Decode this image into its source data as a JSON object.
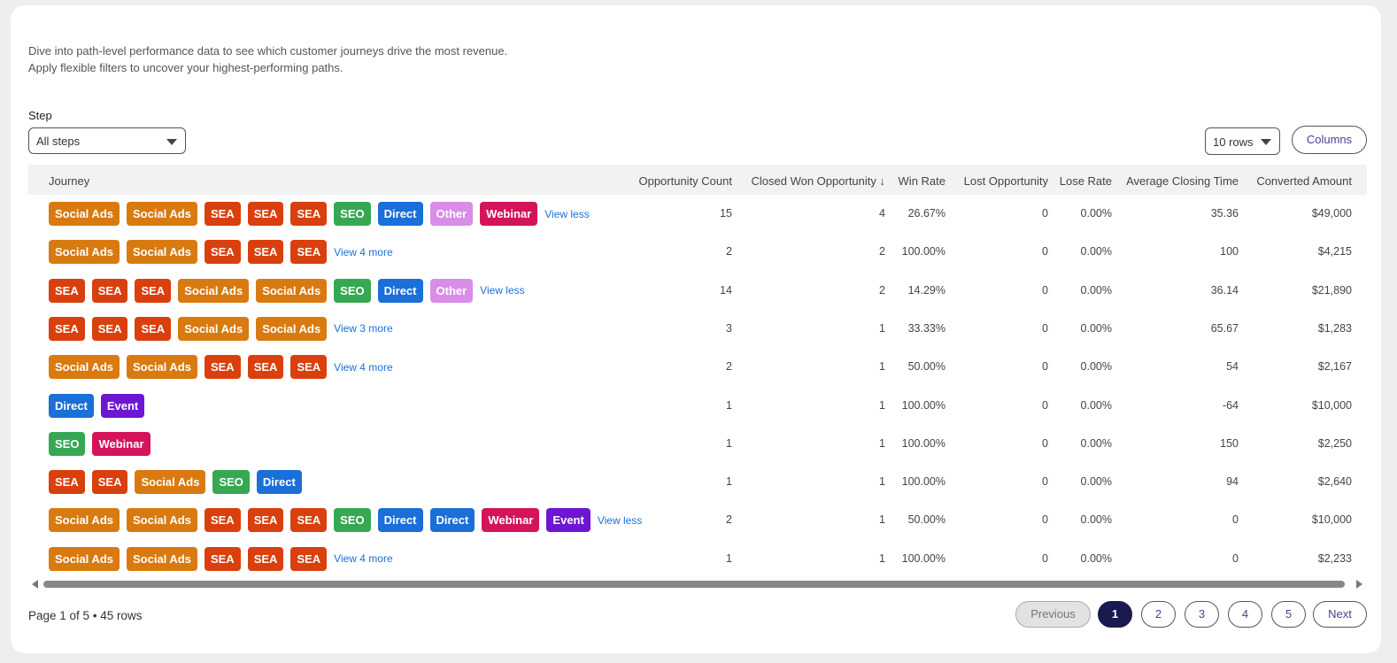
{
  "description": {
    "line1": "Dive into path-level performance data to see which customer journeys drive the most revenue.",
    "line2": "Apply flexible filters to uncover your highest-performing paths."
  },
  "filter": {
    "step_label": "Step",
    "step_value": "All steps"
  },
  "controls": {
    "rows_value": "10 rows",
    "columns_label": "Columns"
  },
  "table": {
    "headers": {
      "journey": "Journey",
      "opp_count": "Opportunity Count",
      "closed_won": "Closed Won Opportunity ↓",
      "win_rate": "Win Rate",
      "lost_opp": "Lost Opportunity",
      "lose_rate": "Lose Rate",
      "avg_closing": "Average Closing Time",
      "converted": "Converted Amount"
    },
    "tag_colors": {
      "Social Ads": "#d97a10",
      "SEA": "#d9400e",
      "SEO": "#36a853",
      "Direct": "#1a6fd8",
      "Other": "#d98de8",
      "Webinar": "#d4145a",
      "Event": "#6c16d4"
    },
    "rows": [
      {
        "tags": [
          "Social Ads",
          "Social Ads",
          "SEA",
          "SEA",
          "SEA",
          "SEO",
          "Direct",
          "Other",
          "Webinar"
        ],
        "more": "View less",
        "opp_count": "15",
        "closed_won": "4",
        "win_rate": "26.67%",
        "lost_opp": "0",
        "lose_rate": "0.00%",
        "avg_closing": "35.36",
        "converted": "$49,000"
      },
      {
        "tags": [
          "Social Ads",
          "Social Ads",
          "SEA",
          "SEA",
          "SEA"
        ],
        "more": "View 4 more",
        "opp_count": "2",
        "closed_won": "2",
        "win_rate": "100.00%",
        "lost_opp": "0",
        "lose_rate": "0.00%",
        "avg_closing": "100",
        "converted": "$4,215"
      },
      {
        "tags": [
          "SEA",
          "SEA",
          "SEA",
          "Social Ads",
          "Social Ads",
          "SEO",
          "Direct",
          "Other"
        ],
        "more": "View less",
        "opp_count": "14",
        "closed_won": "2",
        "win_rate": "14.29%",
        "lost_opp": "0",
        "lose_rate": "0.00%",
        "avg_closing": "36.14",
        "converted": "$21,890"
      },
      {
        "tags": [
          "SEA",
          "SEA",
          "SEA",
          "Social Ads",
          "Social Ads"
        ],
        "more": "View 3 more",
        "opp_count": "3",
        "closed_won": "1",
        "win_rate": "33.33%",
        "lost_opp": "0",
        "lose_rate": "0.00%",
        "avg_closing": "65.67",
        "converted": "$1,283"
      },
      {
        "tags": [
          "Social Ads",
          "Social Ads",
          "SEA",
          "SEA",
          "SEA"
        ],
        "more": "View 4 more",
        "opp_count": "2",
        "closed_won": "1",
        "win_rate": "50.00%",
        "lost_opp": "0",
        "lose_rate": "0.00%",
        "avg_closing": "54",
        "converted": "$2,167"
      },
      {
        "tags": [
          "Direct",
          "Event"
        ],
        "more": "",
        "opp_count": "1",
        "closed_won": "1",
        "win_rate": "100.00%",
        "lost_opp": "0",
        "lose_rate": "0.00%",
        "avg_closing": "-64",
        "converted": "$10,000"
      },
      {
        "tags": [
          "SEO",
          "Webinar"
        ],
        "more": "",
        "opp_count": "1",
        "closed_won": "1",
        "win_rate": "100.00%",
        "lost_opp": "0",
        "lose_rate": "0.00%",
        "avg_closing": "150",
        "converted": "$2,250"
      },
      {
        "tags": [
          "SEA",
          "SEA",
          "Social Ads",
          "SEO",
          "Direct"
        ],
        "more": "",
        "opp_count": "1",
        "closed_won": "1",
        "win_rate": "100.00%",
        "lost_opp": "0",
        "lose_rate": "0.00%",
        "avg_closing": "94",
        "converted": "$2,640"
      },
      {
        "tags": [
          "Social Ads",
          "Social Ads",
          "SEA",
          "SEA",
          "SEA",
          "SEO",
          "Direct",
          "Direct",
          "Webinar",
          "Event"
        ],
        "more": "View less",
        "opp_count": "2",
        "closed_won": "1",
        "win_rate": "50.00%",
        "lost_opp": "0",
        "lose_rate": "0.00%",
        "avg_closing": "0",
        "converted": "$10,000"
      },
      {
        "tags": [
          "Social Ads",
          "Social Ads",
          "SEA",
          "SEA",
          "SEA"
        ],
        "more": "View 4 more",
        "opp_count": "1",
        "closed_won": "1",
        "win_rate": "100.00%",
        "lost_opp": "0",
        "lose_rate": "0.00%",
        "avg_closing": "0",
        "converted": "$2,233"
      }
    ]
  },
  "pagination": {
    "info": "Page 1 of 5 • 45 rows",
    "previous": "Previous",
    "pages": [
      "1",
      "2",
      "3",
      "4",
      "5"
    ],
    "current": "1",
    "next": "Next"
  }
}
